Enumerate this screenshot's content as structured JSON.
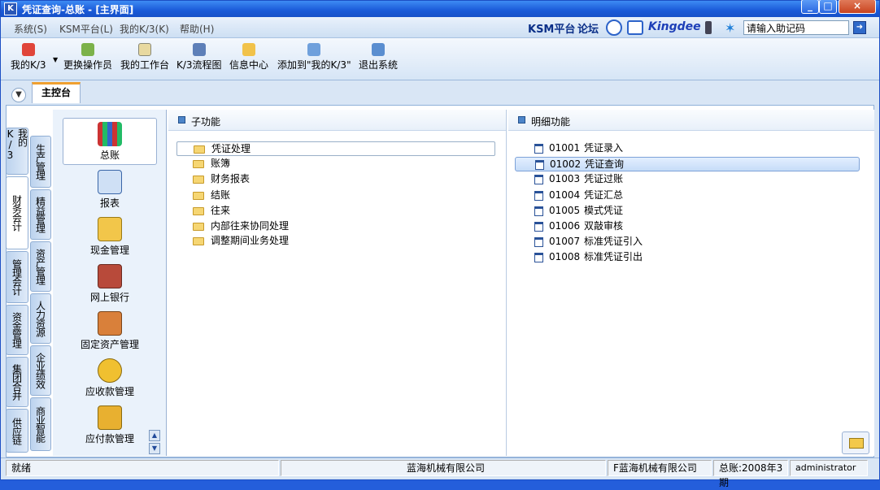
{
  "window": {
    "title": "凭证查询-总账 - [主界面]",
    "app_icon": "K"
  },
  "menubar": {
    "items": [
      "系统(S)",
      "KSM平台(L)",
      "我的K/3(K)",
      "帮助(H)"
    ],
    "ksm_link": "KSM平台",
    "forum_link": "论坛",
    "brand": "Kingdee",
    "search_value": "请输入助记码"
  },
  "toolbar": {
    "buttons": [
      {
        "label": "我的K/3",
        "icon": "star-icon"
      },
      {
        "label": "更换操作员",
        "icon": "users-icon"
      },
      {
        "label": "我的工作台",
        "icon": "pen-icon"
      },
      {
        "label": "K/3流程图",
        "icon": "flowchart-icon"
      },
      {
        "label": "信息中心",
        "icon": "chat-icon"
      },
      {
        "label": "添加到\"我的K/3\"",
        "icon": "edit-add-icon"
      },
      {
        "label": "退出系统",
        "icon": "exit-icon"
      }
    ]
  },
  "tabs": {
    "main": "主控台"
  },
  "vtabs_left": [
    "我的K/3",
    "财务会计",
    "管理会计",
    "资金管理",
    "集团合并",
    "供应链"
  ],
  "vtabs_right": [
    "生产管理",
    "精益管理",
    "资产管理",
    "人力资源",
    "企业绩效",
    "商业智能"
  ],
  "modules": [
    {
      "label": "总账",
      "icon": "ledger-books-icon"
    },
    {
      "label": "报表",
      "icon": "report-icon"
    },
    {
      "label": "现金管理",
      "icon": "cash-icon"
    },
    {
      "label": "网上银行",
      "icon": "bank-icon"
    },
    {
      "label": "固定资产管理",
      "icon": "truck-icon"
    },
    {
      "label": "应收款管理",
      "icon": "money-bag-icon"
    },
    {
      "label": "应付款管理",
      "icon": "payment-icon"
    }
  ],
  "subfunctions": {
    "header": "子功能",
    "items": [
      "凭证处理",
      "账簿",
      "财务报表",
      "结账",
      "往来",
      "内部往来协同处理",
      "调整期间业务处理"
    ]
  },
  "details": {
    "header": "明细功能",
    "items": [
      {
        "code": "01001",
        "name": "凭证录入"
      },
      {
        "code": "01002",
        "name": "凭证查询"
      },
      {
        "code": "01003",
        "name": "凭证过账"
      },
      {
        "code": "01004",
        "name": "凭证汇总"
      },
      {
        "code": "01005",
        "name": "模式凭证"
      },
      {
        "code": "01006",
        "name": "双敲审核"
      },
      {
        "code": "01007",
        "name": "标准凭证引入"
      },
      {
        "code": "01008",
        "name": "标准凭证引出"
      }
    ]
  },
  "statusbar": {
    "state": "就绪",
    "company": "蓝海机械有限公司",
    "company2": "F蓝海机械有限公司",
    "period": "总账:2008年3期",
    "user": "administrator"
  },
  "colors": {
    "title_bar": "#1a5ad8",
    "accent": "#f0a030",
    "selection": "#c6dcf8"
  }
}
